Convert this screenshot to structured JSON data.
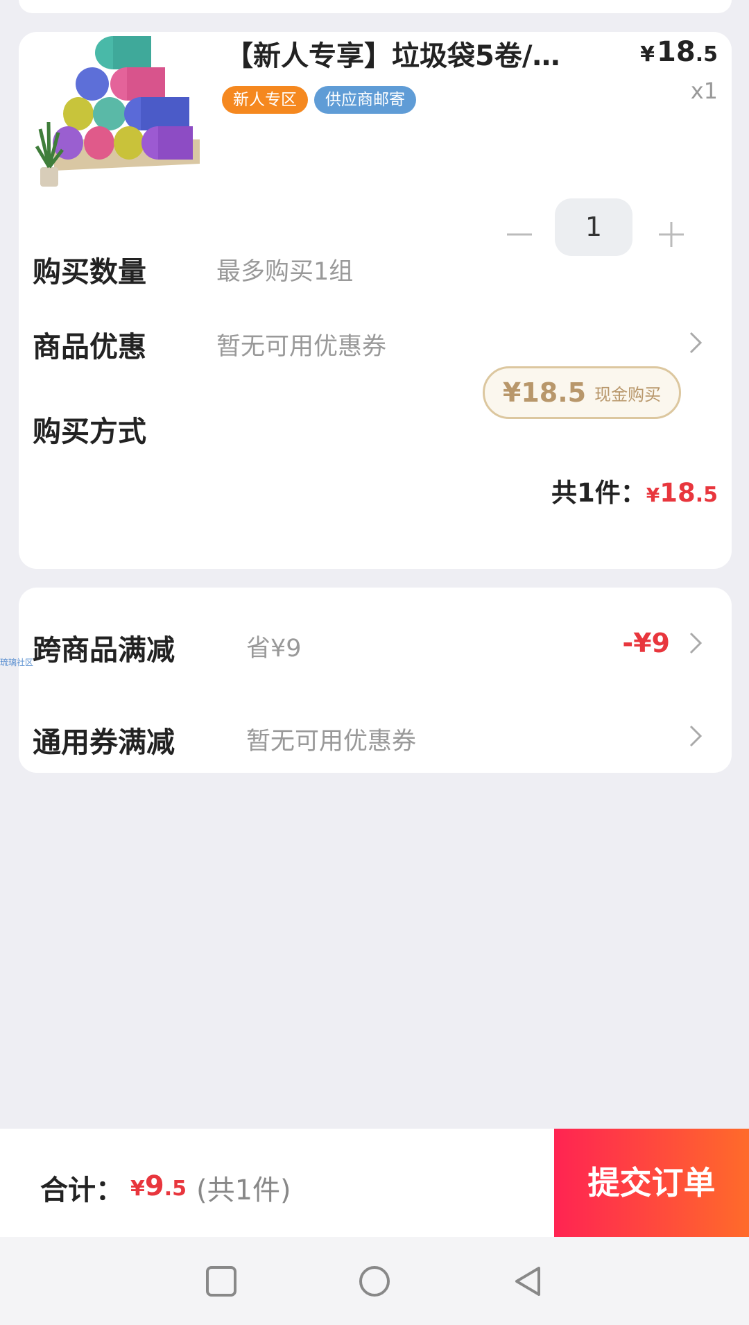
{
  "product": {
    "title": "【新人专享】垃圾袋5卷/…",
    "price_symbol": "¥",
    "price_int": "18",
    "price_dec": ".5",
    "quantity_label": "x1",
    "tags": [
      "新人专区",
      "供应商邮寄"
    ]
  },
  "purchase_quantity": {
    "label": "购买数量",
    "hint": "最多购买1组",
    "value": "1"
  },
  "product_discount": {
    "label": "商品优惠",
    "hint": "暂无可用优惠券"
  },
  "purchase_method": {
    "label": "购买方式",
    "price": "¥18.5",
    "mode": "现金购买"
  },
  "subtotal": {
    "label": "共1件：",
    "symbol": "¥",
    "int": "18",
    "dec": ".5"
  },
  "cross_discount": {
    "label": "跨商品满减",
    "hint": "省¥9",
    "amount": "-¥9"
  },
  "general_coupon": {
    "label": "通用券满减",
    "hint": "暂无可用优惠券"
  },
  "watermark": "琉璃社区",
  "footer": {
    "total_label": "合计：",
    "symbol": "¥",
    "int": "9",
    "dec": ".5",
    "count": "(共1件)",
    "submit_label": "提交订单"
  },
  "colors": {
    "accent_red": "#e8363d",
    "tag_orange": "#f5881f",
    "tag_blue": "#5f9cd6",
    "gold": "#b8976b"
  },
  "icons": [
    "chevron-right-icon",
    "minus-icon",
    "plus-icon",
    "square-nav-icon",
    "circle-nav-icon",
    "back-triangle-icon"
  ]
}
